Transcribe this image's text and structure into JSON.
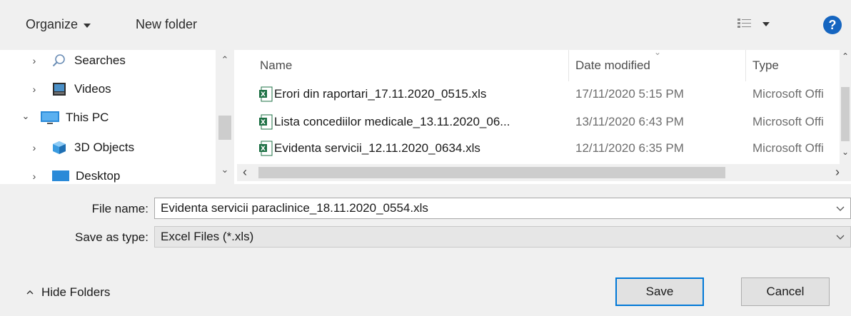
{
  "toolbar": {
    "organize_label": "Organize",
    "new_folder_label": "New folder",
    "view_icon": "view-options-icon",
    "help_label": "?"
  },
  "nav": {
    "items": [
      {
        "label": "Searches",
        "icon": "search-icon",
        "expanded": false
      },
      {
        "label": "Videos",
        "icon": "videos-folder-icon",
        "expanded": false
      },
      {
        "label": "This PC",
        "icon": "computer-icon",
        "expanded": true
      },
      {
        "label": "3D Objects",
        "icon": "3d-objects-icon",
        "expanded": false
      },
      {
        "label": "Desktop",
        "icon": "desktop-icon",
        "expanded": false
      }
    ]
  },
  "files": {
    "columns": {
      "name": "Name",
      "date": "Date modified",
      "type": "Type"
    },
    "rows": [
      {
        "name": "Erori din raportari_17.11.2020_0515.xls",
        "date": "17/11/2020 5:15 PM",
        "type": "Microsoft Offi"
      },
      {
        "name": "Lista concediilor medicale_13.11.2020_06...",
        "date": "13/11/2020 6:43 PM",
        "type": "Microsoft Offi"
      },
      {
        "name": "Evidenta servicii_12.11.2020_0634.xls",
        "date": "12/11/2020 6:35 PM",
        "type": "Microsoft Offi"
      }
    ]
  },
  "form": {
    "file_name_label": "File name:",
    "file_name_value": "Evidenta servicii paraclinice_18.11.2020_0554.xls",
    "save_type_label": "Save as type:",
    "save_type_value": "Excel Files (*.xls)"
  },
  "footer": {
    "hide_folders_label": "Hide Folders",
    "save_label": "Save",
    "cancel_label": "Cancel"
  },
  "colors": {
    "accent": "#0078d7",
    "help": "#1565c0",
    "excel_green": "#1d7044"
  }
}
